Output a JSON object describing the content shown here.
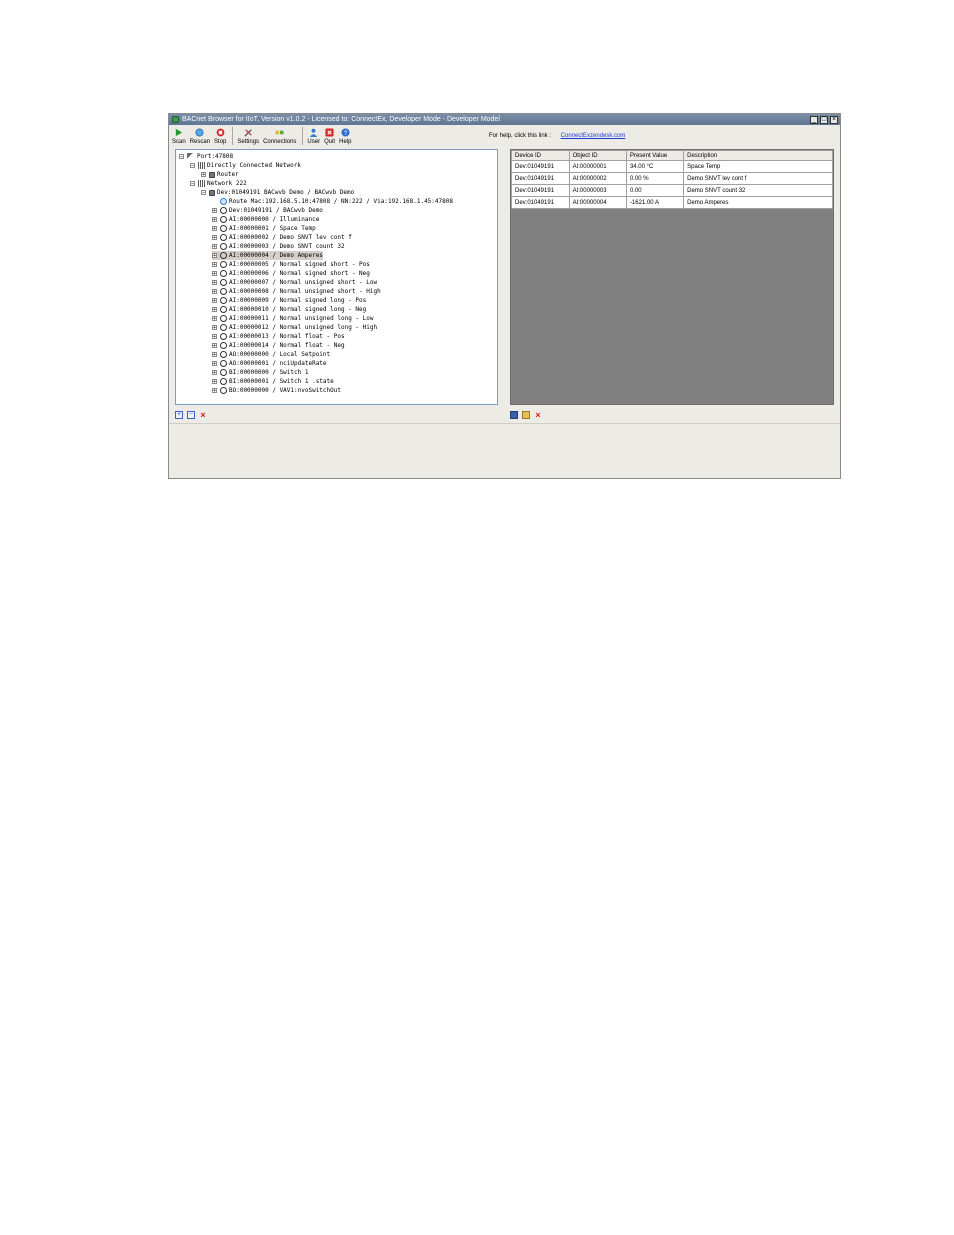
{
  "window": {
    "title": "BACnet Browser for IIoT, Version v1.0.2 - Licensed to: ConnectEx, Developer Mode - Developer Model"
  },
  "toolbar": {
    "buttons": [
      {
        "label": "Scan",
        "icon": "play-icon"
      },
      {
        "label": "Rescan",
        "icon": "rescan-icon"
      },
      {
        "label": "Stop",
        "icon": "stop-icon"
      },
      {
        "label": "Settings",
        "icon": "settings-icon"
      },
      {
        "label": "Connections",
        "icon": "connections-icon"
      },
      {
        "label": "User",
        "icon": "user-icon"
      },
      {
        "label": "Quit",
        "icon": "quit-icon"
      },
      {
        "label": "Help",
        "icon": "help-icon"
      }
    ],
    "help_text": "For help, click this link :",
    "help_link": "ConnectExzendesk.com"
  },
  "tree": {
    "items": [
      {
        "text": "Port:47808",
        "expander": "−"
      },
      {
        "text": "Directly Connected Network",
        "expander": "−"
      },
      {
        "text": "Router",
        "expander": "+"
      },
      {
        "text": "Network 222",
        "expander": "−"
      },
      {
        "text": "Dev:01049191 BACwvb Demo / BACwvb Demo",
        "expander": "−"
      },
      {
        "text": "Route  Mac:192.168.5.10:47808 / NN:222 / Via:192.168.1.45:47808",
        "expander": ""
      },
      {
        "text": "Dev:01049191 / BACwvb Demo",
        "expander": "+"
      },
      {
        "text": "AI:00000000 / Illuminance",
        "expander": "+"
      },
      {
        "text": "AI:00000001 / Space Temp",
        "expander": "+"
      },
      {
        "text": "AI:00000002 / Demo SNVT lev cont f",
        "expander": "+"
      },
      {
        "text": "AI:00000003 / Demo SNVT count 32",
        "expander": "+"
      },
      {
        "text": "AI:00000004 / Demo  Amperes",
        "expander": "+"
      },
      {
        "text": "AI:00000005 / Normal signed short - Pos",
        "expander": "+"
      },
      {
        "text": "AI:00000006 / Normal signed short - Neg",
        "expander": "+"
      },
      {
        "text": "AI:00000007 / Normal unsigned short - Low",
        "expander": "+"
      },
      {
        "text": "AI:00000008 / Normal unsigned short - High",
        "expander": "+"
      },
      {
        "text": "AI:00000009 / Normal signed long - Pos",
        "expander": "+"
      },
      {
        "text": "AI:00000010 / Normal signed long - Neg",
        "expander": "+"
      },
      {
        "text": "AI:00000011 / Normal unsigned long - Low",
        "expander": "+"
      },
      {
        "text": "AI:00000012 / Normal unsigned long - High",
        "expander": "+"
      },
      {
        "text": "AI:00000013 / Normal float - Pos",
        "expander": "+"
      },
      {
        "text": "AI:00000014 / Normal float - Neg",
        "expander": "+"
      },
      {
        "text": "AO:00000000 / Local Setpoint",
        "expander": "+"
      },
      {
        "text": "AO:00000001 / nciUpdateRate",
        "expander": "+"
      },
      {
        "text": "BI:00000000 / Switch 1",
        "expander": "+"
      },
      {
        "text": "BI:00000001 / Switch 1 .state",
        "expander": "+"
      },
      {
        "text": "BO:00000000 / VAV1:nvoSwitchOut",
        "expander": "+"
      }
    ]
  },
  "grid": {
    "columns": [
      "Device ID",
      "Object ID",
      "Present Value",
      "Description"
    ],
    "rows": [
      [
        "Dev:01049191",
        "AI:00000001",
        "34.00 °C",
        "Space Temp"
      ],
      [
        "Dev:01049191",
        "AI:00000002",
        "0.00 %",
        "Demo SNVT lev cont f"
      ],
      [
        "Dev:01049191",
        "AI:00000003",
        "0.00",
        "Demo SNVT count 32"
      ],
      [
        "Dev:01049191",
        "AI:00000004",
        "-1621.00 A",
        "Demo Amperes"
      ]
    ]
  }
}
